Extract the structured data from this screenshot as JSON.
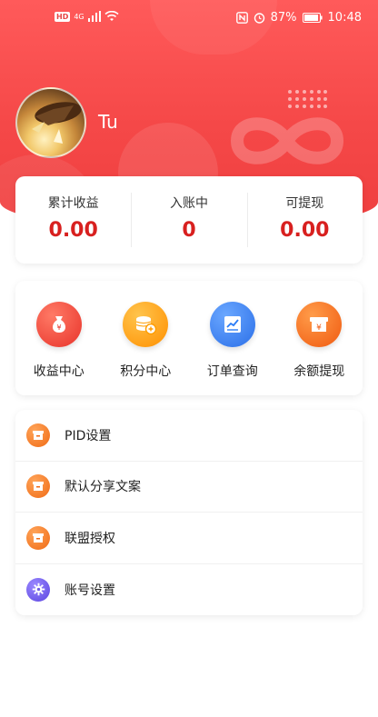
{
  "status_bar": {
    "network": "4G",
    "hd_badge": "HD",
    "battery": "87%",
    "time": "10:48"
  },
  "profile": {
    "username": "Tu"
  },
  "stats": [
    {
      "label": "累计收益",
      "value": "0.00"
    },
    {
      "label": "入账中",
      "value": "0"
    },
    {
      "label": "可提现",
      "value": "0.00"
    }
  ],
  "actions": [
    {
      "label": "收益中心",
      "icon": "money-bag-icon",
      "color": "#f0443a"
    },
    {
      "label": "积分中心",
      "icon": "coins-icon",
      "color": "#ff9c00"
    },
    {
      "label": "订单查询",
      "icon": "chart-document-icon",
      "color": "#2b7cf6"
    },
    {
      "label": "余额提现",
      "icon": "yen-box-icon",
      "color": "#ff6a1a"
    }
  ],
  "menu": [
    {
      "label": "PID设置",
      "icon": "archive-box-icon",
      "color": "#ff7a1a"
    },
    {
      "label": "默认分享文案",
      "icon": "archive-box-icon",
      "color": "#ff7a1a"
    },
    {
      "label": "联盟授权",
      "icon": "archive-box-icon",
      "color": "#ff7a1a"
    },
    {
      "label": "账号设置",
      "icon": "gear-icon",
      "color": "#6e5ce6"
    }
  ],
  "colors": {
    "header": "#f54848",
    "accent_value": "#d8201f"
  }
}
